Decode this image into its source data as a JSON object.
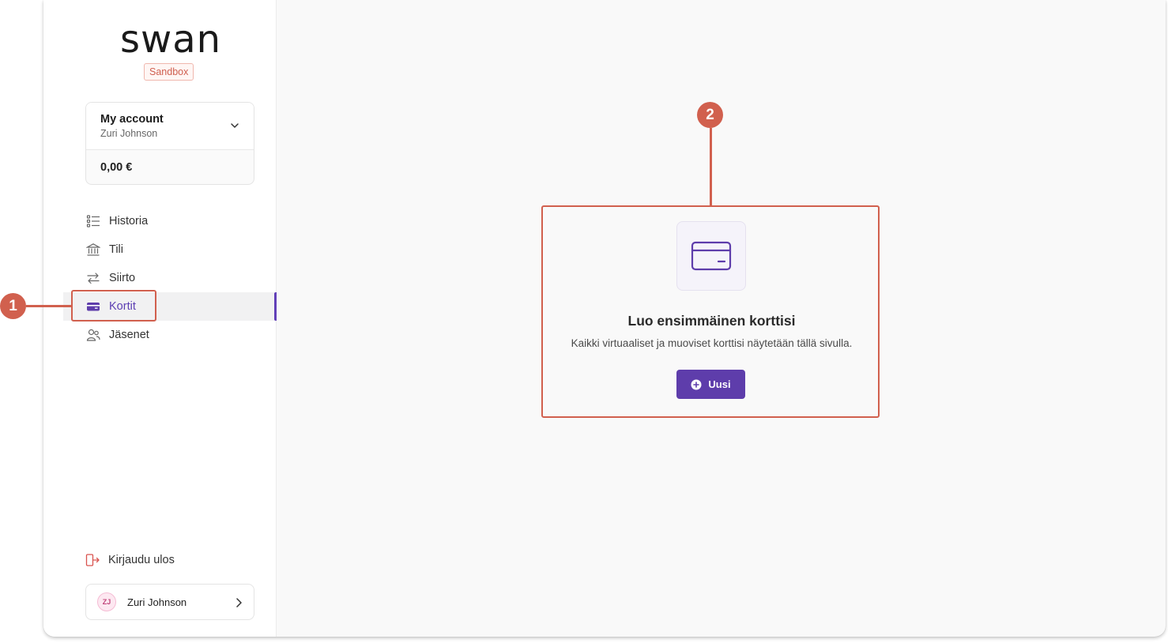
{
  "brand": {
    "logo_text": "swan",
    "environment_badge": "Sandbox"
  },
  "account": {
    "title": "My account",
    "owner": "Zuri Johnson",
    "balance": "0,00 €"
  },
  "nav": {
    "items": [
      {
        "label": "Historia",
        "icon": "list-icon"
      },
      {
        "label": "Tili",
        "icon": "bank-icon"
      },
      {
        "label": "Siirto",
        "icon": "transfer-arrows-icon"
      },
      {
        "label": "Kortit",
        "icon": "card-icon",
        "active": true
      },
      {
        "label": "Jäsenet",
        "icon": "members-icon"
      }
    ]
  },
  "footer": {
    "logout_label": "Kirjaudu ulos",
    "user_initials": "ZJ",
    "user_name": "Zuri Johnson"
  },
  "empty_state": {
    "title": "Luo ensimmäinen korttisi",
    "description": "Kaikki virtuaaliset ja muoviset korttisi näytetään tällä sivulla.",
    "button_label": "Uusi"
  },
  "annotations": {
    "marker_1": "1",
    "marker_2": "2"
  },
  "colors": {
    "accent": "#5e3dab",
    "annotation": "#d1604e",
    "badge_text": "#cf5f4f"
  }
}
